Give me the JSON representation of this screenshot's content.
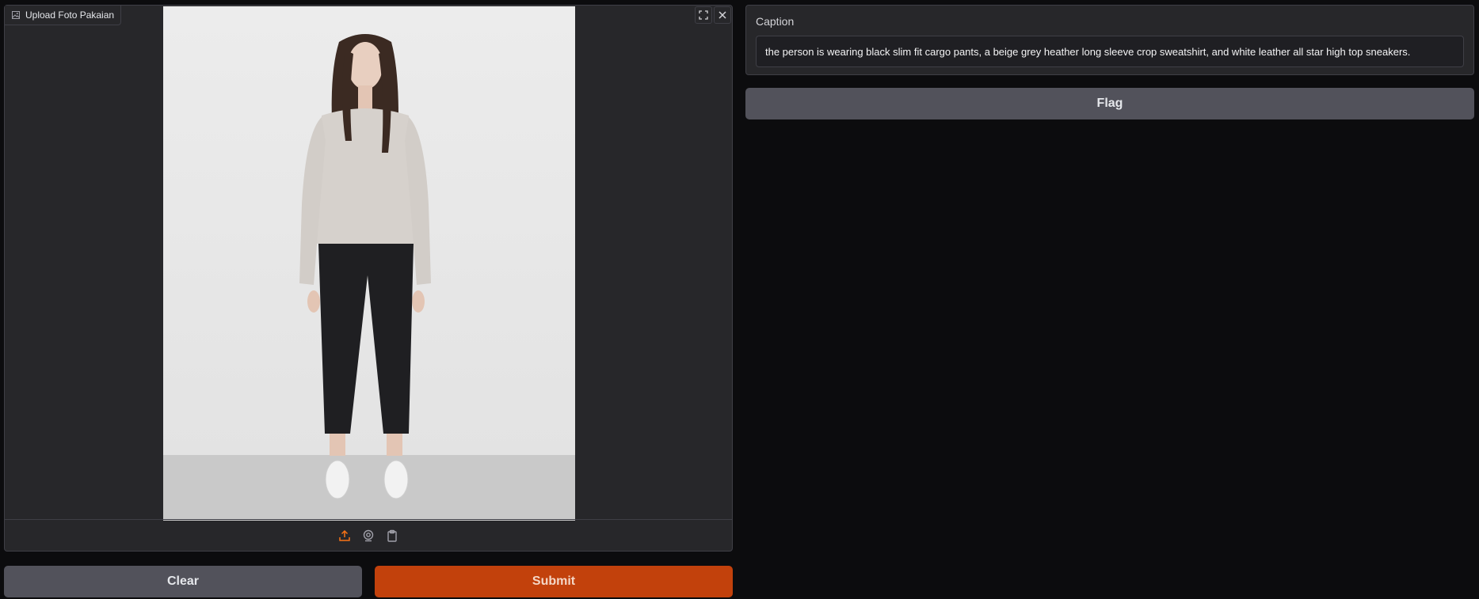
{
  "image_input": {
    "label": "Upload Foto Pakaian",
    "label_icon": "image-icon",
    "controls": [
      "fullscreen-icon",
      "close-icon"
    ],
    "sources": [
      "upload-icon",
      "webcam-icon",
      "clipboard-icon"
    ],
    "accent": "#f97316"
  },
  "buttons": {
    "clear": "Clear",
    "submit": "Submit",
    "flag": "Flag"
  },
  "caption": {
    "label": "Caption",
    "value": "the person is wearing black slim fit cargo pants, a beige grey heather long sleeve crop sweatshirt, and white leather all star high top sneakers."
  },
  "colors": {
    "background": "#0c0c0e",
    "panel": "#27272a",
    "submit": "#c2410c",
    "secondary_button": "#52525b"
  }
}
